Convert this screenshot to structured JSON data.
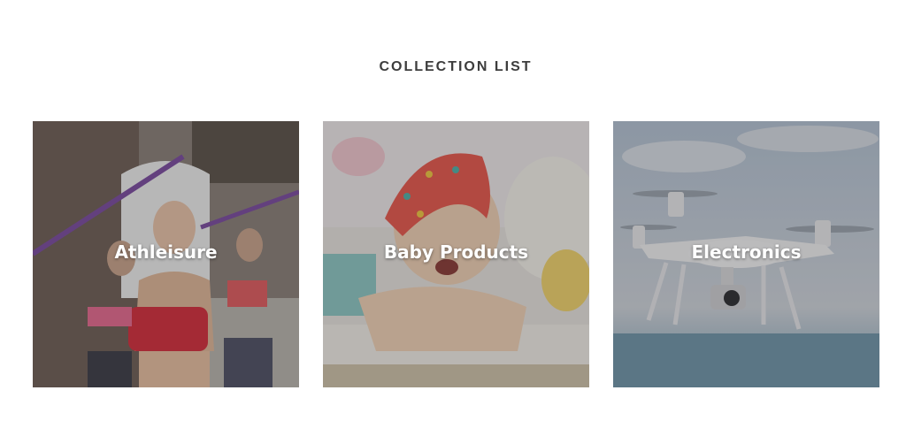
{
  "section": {
    "title": "COLLECTION LIST"
  },
  "collections": [
    {
      "label": "Athleisure",
      "image": "athleisure-fitness-photo"
    },
    {
      "label": "Baby Products",
      "image": "baby-with-headscarf-photo"
    },
    {
      "label": "Electronics",
      "image": "drone-in-sky-photo"
    }
  ]
}
